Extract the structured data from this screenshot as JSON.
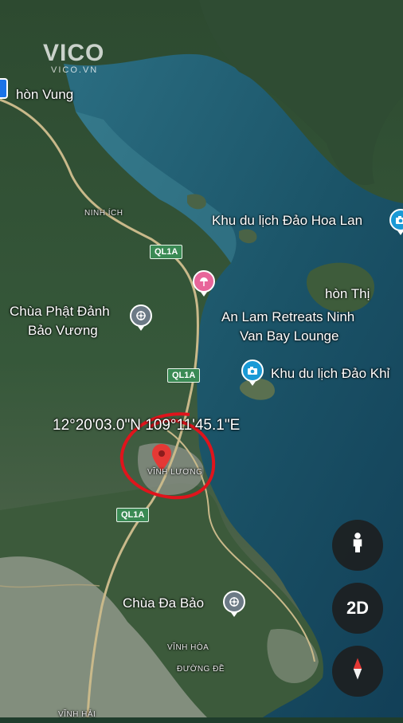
{
  "watermark": {
    "logo": "VICO",
    "sub": "VICO.VN"
  },
  "places": {
    "hon_vung": "hòn Vung",
    "ninh_ich": "NINH ÍCH",
    "hoa_lan": "Khu du lịch Đảo Hoa Lan",
    "hon_thi": "hòn Thị",
    "chua_phat_line1": "Chùa Phật Đảnh",
    "chua_phat_line2": "Bảo Vương",
    "an_lam_line1": "An Lam Retreats Ninh",
    "an_lam_line2": "Van Bay Lounge",
    "dao_khi": "Khu du lịch Đảo Khỉ",
    "vinh_luong": "VĨNH LƯƠNG",
    "chua_da_bao": "Chùa Đa Bảo",
    "vinh_hoa": "VĨNH HÒA",
    "duong_de": "ĐƯỜNG ĐỀ",
    "vinh_hai": "VĨNH HẢI"
  },
  "coordinates": "12°20'03.0\"N 109°11'45.1\"E",
  "roads": {
    "shield_label": "QL1A"
  },
  "controls": {
    "street_view_label": "",
    "view_mode": "2D"
  },
  "icons": {
    "street_view": "pegman-icon",
    "compass": "compass-icon",
    "location_pin": "map-pin-icon"
  },
  "colors": {
    "pin_red": "#e53935",
    "annotation_circle": "#e0141c",
    "water": "#1d5a6e"
  }
}
